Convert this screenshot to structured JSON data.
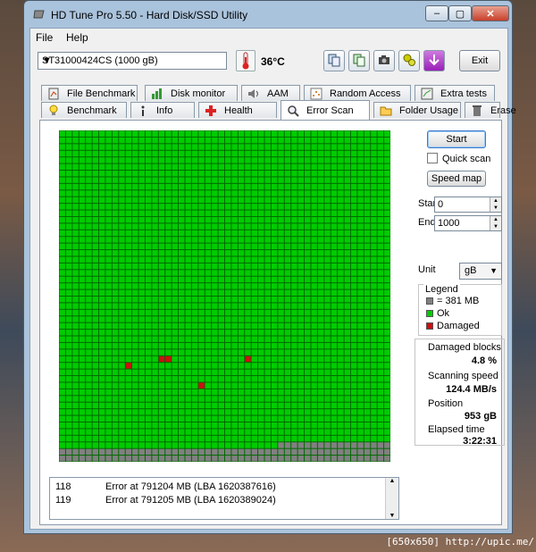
{
  "window": {
    "title": "HD Tune Pro 5.50 - Hard Disk/SSD Utility",
    "caption_min": "–",
    "caption_max": "▢",
    "caption_close": "✕"
  },
  "menu": {
    "file": "File",
    "help": "Help"
  },
  "toolbar": {
    "drive": "ST31000424CS (1000 gB)",
    "temperature": "36°C",
    "exit_label": "Exit"
  },
  "tabs": {
    "row1": [
      "File Benchmark",
      "Disk monitor",
      "AAM",
      "Random Access",
      "Extra tests"
    ],
    "row2": [
      "Benchmark",
      "Info",
      "Health",
      "Error Scan",
      "Folder Usage",
      "Erase"
    ],
    "active": "Error Scan"
  },
  "controls": {
    "start_label": "Start",
    "quick_scan_label": "Quick scan",
    "quick_scan_checked": false,
    "speed_map_label": "Speed map",
    "start_field_label": "Start",
    "start_value": "0",
    "end_field_label": "End",
    "end_value": "1000",
    "unit_label": "Unit",
    "unit_value": "gB"
  },
  "legend": {
    "title": "Legend",
    "items": [
      {
        "label": "= 381 MB",
        "color": "#808080"
      },
      {
        "label": "Ok",
        "color": "#00cc00"
      },
      {
        "label": "Damaged",
        "color": "#cc1010"
      }
    ]
  },
  "stats": {
    "damaged_blocks_label": "Damaged blocks",
    "damaged_blocks_value": "4.8 %",
    "scanning_speed_label": "Scanning speed",
    "scanning_speed_value": "124.4 MB/s",
    "position_label": "Position",
    "position_value": "953 gB",
    "elapsed_label": "Elapsed time",
    "elapsed_value": "3:22:31"
  },
  "log": [
    {
      "num": "118",
      "message": "Error at 791204 MB (LBA 1620387616)"
    },
    {
      "num": "119",
      "message": "Error at 791205 MB (LBA 1620389024)"
    }
  ],
  "scan_grid": {
    "columns": 50,
    "rows": 50,
    "colors": {
      "ok": "#00cc00",
      "unscanned": "#808080",
      "damaged": "#cc1010",
      "gridline": "#006a00"
    },
    "scanned_fraction": 0.953,
    "damaged_cells": [
      [
        35,
        10
      ],
      [
        34,
        15
      ],
      [
        34,
        16
      ],
      [
        34,
        28
      ],
      [
        38,
        21
      ]
    ]
  },
  "watermark": "[650x650] http://upic.me/"
}
